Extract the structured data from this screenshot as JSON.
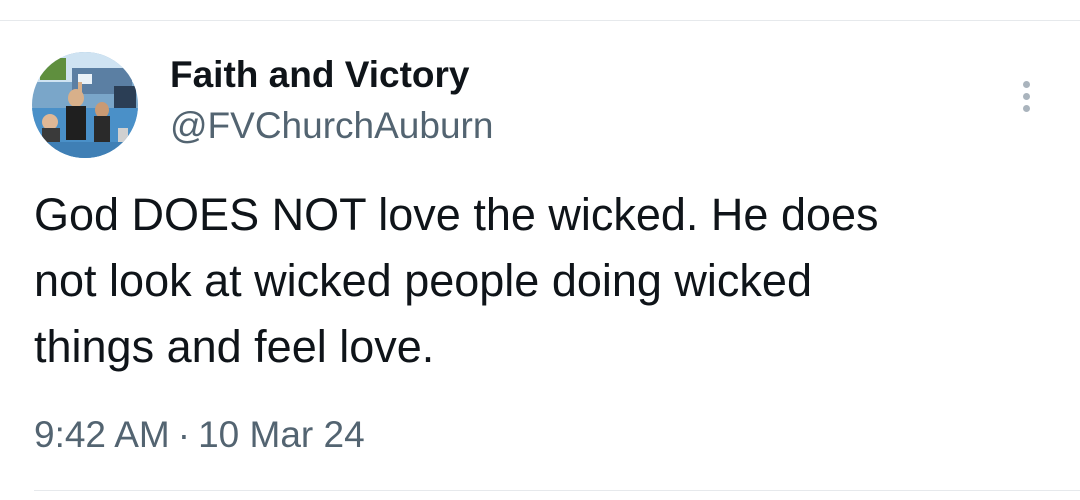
{
  "tweet": {
    "author": {
      "display_name": "Faith and Victory",
      "handle": "@FVChurchAuburn",
      "avatar_icon": "profile-photo"
    },
    "more_icon": "more-vertical-icon",
    "text": "God DOES NOT love the wicked.  He does\nnot look at wicked people doing wicked\nthings and feel love.",
    "time": "9:42 AM",
    "separator": "·",
    "date": "10 Mar 24"
  },
  "colors": {
    "text_primary": "#0f1419",
    "text_secondary": "#536471",
    "divider": "#e6e9ec"
  }
}
